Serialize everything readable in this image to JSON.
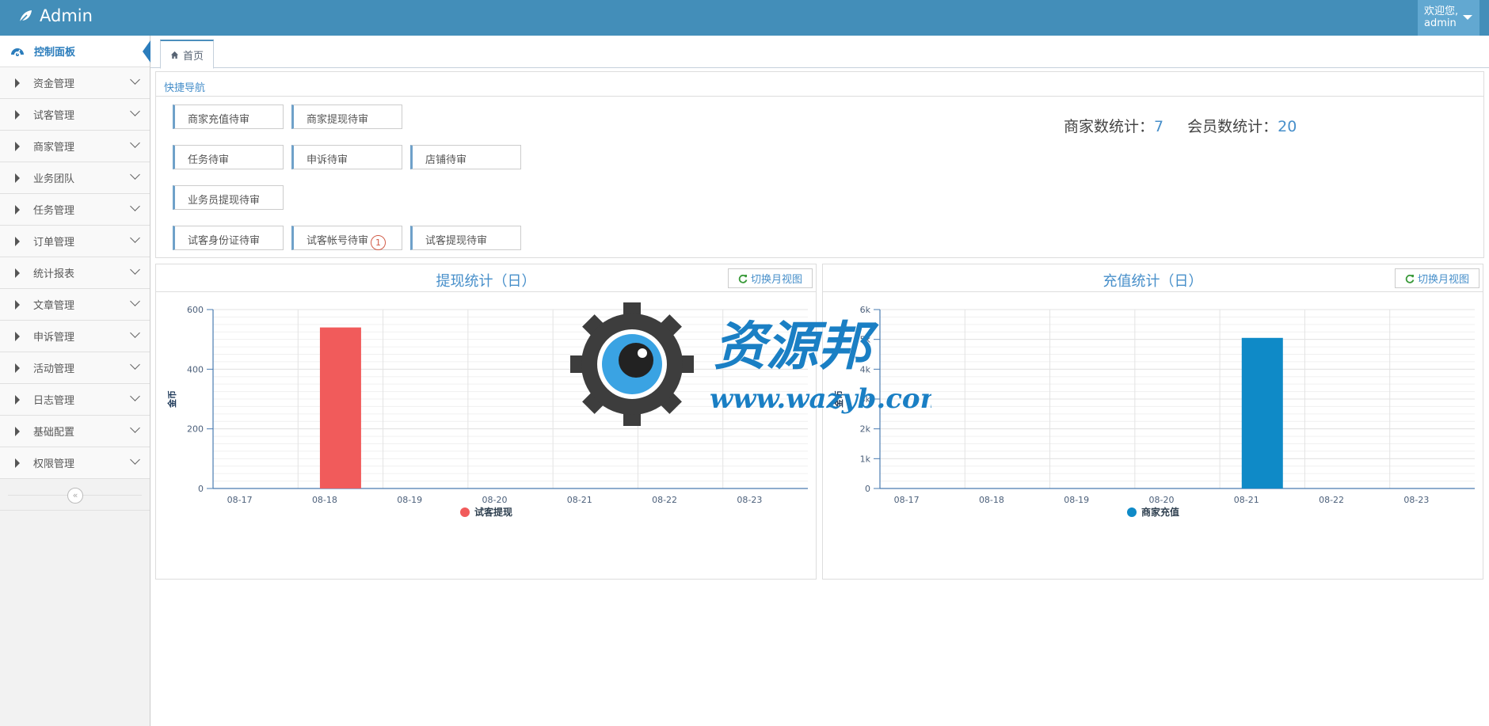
{
  "navbar": {
    "brand": "Admin",
    "welcome": "欢迎您,",
    "username": "admin"
  },
  "sidebar": {
    "items": [
      {
        "label": "控制面板",
        "active": true
      },
      {
        "label": "资金管理"
      },
      {
        "label": "试客管理"
      },
      {
        "label": "商家管理"
      },
      {
        "label": "业务团队"
      },
      {
        "label": "任务管理"
      },
      {
        "label": "订单管理"
      },
      {
        "label": "统计报表"
      },
      {
        "label": "文章管理"
      },
      {
        "label": "申诉管理"
      },
      {
        "label": "活动管理"
      },
      {
        "label": "日志管理"
      },
      {
        "label": "基础配置"
      },
      {
        "label": "权限管理"
      }
    ],
    "collapse_glyph": "«"
  },
  "tabs": [
    {
      "label": "首页"
    }
  ],
  "quick_nav": {
    "title": "快捷导航",
    "buttons": [
      {
        "label": "商家充值待审"
      },
      {
        "label": "商家提现待审"
      },
      {
        "label": "任务待审"
      },
      {
        "label": "申诉待审"
      },
      {
        "label": "店铺待审"
      },
      {
        "label": "业务员提现待审"
      },
      {
        "label": "试客身份证待审"
      },
      {
        "label": "试客帐号待审",
        "badge": "1"
      },
      {
        "label": "试客提现待审"
      }
    ],
    "stats": {
      "merchant_label": "商家数统计：",
      "merchant_count": "7",
      "member_label": "会员数统计：",
      "member_count": "20"
    }
  },
  "watermark": {
    "title": "资源邦",
    "url": "www.wazyb.com"
  },
  "chart_data": [
    {
      "type": "bar",
      "title": "提现统计（日）",
      "switch_label": "切换月视图",
      "categories": [
        "08-17",
        "08-18",
        "08-19",
        "08-20",
        "08-21",
        "08-22",
        "08-23"
      ],
      "series": [
        {
          "name": "试客提现",
          "values": [
            0,
            540,
            0,
            0,
            0,
            0,
            0
          ],
          "color": "#f15b5b"
        }
      ],
      "ylabel": "金币",
      "ylim": [
        0,
        600
      ],
      "yticks": [
        0,
        200,
        400,
        600
      ],
      "ytick_labels": [
        "0",
        "200",
        "400",
        "600"
      ],
      "grid": true,
      "legend": "bottom-center"
    },
    {
      "type": "bar",
      "title": "充值统计（日）",
      "switch_label": "切换月视图",
      "categories": [
        "08-17",
        "08-18",
        "08-19",
        "08-20",
        "08-21",
        "08-22",
        "08-23"
      ],
      "series": [
        {
          "name": "商家充值",
          "values": [
            0,
            0,
            0,
            0,
            5050,
            0,
            0
          ],
          "color": "#0f8ac7"
        }
      ],
      "ylabel": "金币",
      "ylim": [
        0,
        6000
      ],
      "yticks": [
        0,
        1000,
        2000,
        3000,
        4000,
        5000,
        6000
      ],
      "ytick_labels": [
        "0",
        "1k",
        "2k",
        "3k",
        "4k",
        "5k",
        "6k"
      ],
      "grid": true,
      "legend": "bottom-center"
    }
  ]
}
